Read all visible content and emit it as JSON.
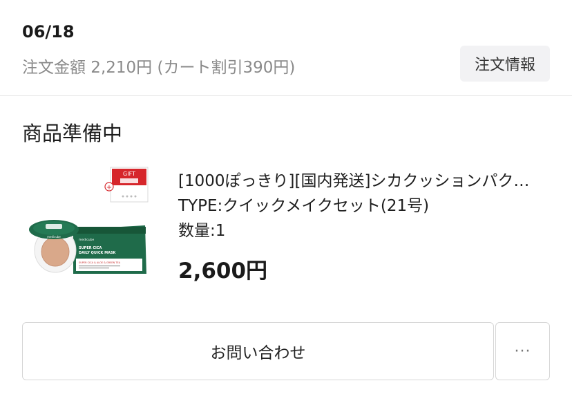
{
  "order": {
    "date": "06/18",
    "amount_text": "注文金額 2,210円 (カート割引390円)",
    "info_button_label": "注文情報"
  },
  "status": {
    "title": "商品準備中"
  },
  "product": {
    "name": "[1000ぽっきり][国内発送]シカクッションパク…",
    "option": "TYPE:クイックメイクセット(21号)",
    "quantity": "数量:1",
    "price": "2,600円",
    "image": {
      "gift_label": "GIFT",
      "brand": "medicube",
      "mask_line1": "SUPER CICA",
      "mask_line2": "DAILY QUICK MASK",
      "mask_sub": "SUPER CICA & ALOE & GREEN TEA"
    }
  },
  "actions": {
    "contact_label": "お問い合わせ",
    "more_label": "···"
  },
  "colors": {
    "accent_green": "#1f6b4a",
    "gift_red": "#d6262b",
    "button_bg": "#f2f2f4",
    "muted_text": "#8a8a8a"
  }
}
